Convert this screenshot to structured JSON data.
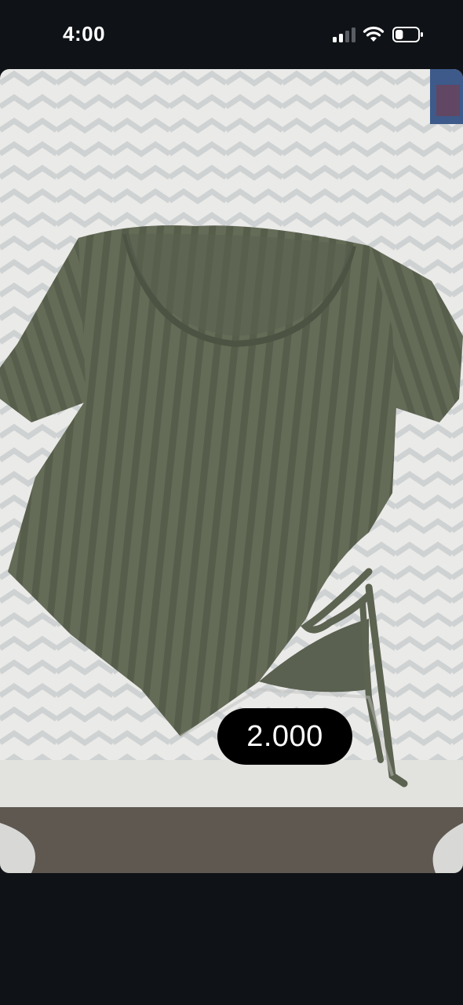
{
  "status_bar": {
    "time": "4:00",
    "signal_icon": "cellular-signal-icon",
    "wifi_icon": "wifi-icon",
    "battery_icon": "battery-icon",
    "battery_level": 0.35,
    "signal_bars_active": 2,
    "signal_bars_total": 4
  },
  "post": {
    "image_description_icon": "product-photo",
    "price_label": "2.000"
  },
  "colors": {
    "background": "#0f1216",
    "shirt": "#5e6551",
    "blanket": "#e6e6e2",
    "badge": "#000000"
  }
}
